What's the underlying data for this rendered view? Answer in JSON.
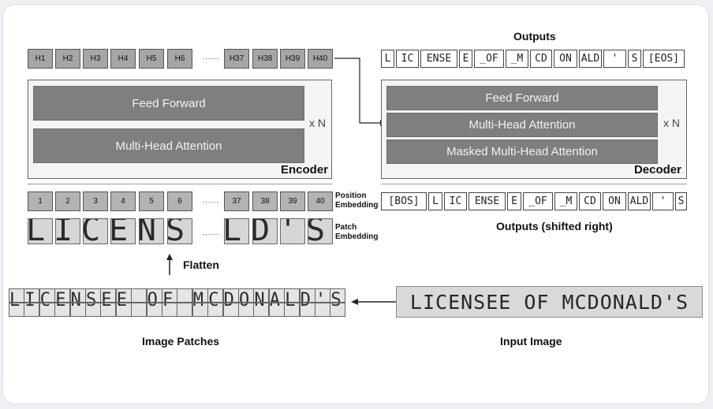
{
  "hidden_states": [
    "H1",
    "H2",
    "H3",
    "H4",
    "H5",
    "H6",
    "H37",
    "H38",
    "H39",
    "H40"
  ],
  "ellipsis": "......",
  "positions": [
    "1",
    "2",
    "3",
    "4",
    "5",
    "6",
    "37",
    "38",
    "39",
    "40"
  ],
  "patch_glyphs": [
    "L",
    "I",
    "C",
    "E",
    "N",
    "S",
    "L",
    "D",
    "'",
    "S"
  ],
  "encoder": {
    "feed_forward": "Feed Forward",
    "attention": "Multi-Head Attention",
    "repeat": "x N",
    "label": "Encoder"
  },
  "decoder": {
    "feed_forward": "Feed Forward",
    "attention": "Multi-Head Attention",
    "masked_attention": "Masked Multi-Head Attention",
    "repeat": "x N",
    "label": "Decoder"
  },
  "outputs_title": "Outputs",
  "output_tokens": [
    "L",
    "IC",
    "ENSE",
    "E",
    "_OF",
    "_M",
    "CD",
    "ON",
    "ALD",
    "'",
    "S",
    "[EOS]"
  ],
  "shifted_tokens": [
    "[BOS]",
    "L",
    "IC",
    "ENSE",
    "E",
    "_OF",
    "_M",
    "CD",
    "ON",
    "ALD",
    "'",
    "S"
  ],
  "shifted_caption": "Outputs (shifted right)",
  "position_embedding_label": [
    "Position",
    "Embedding"
  ],
  "patch_embedding_label": [
    "Patch",
    "Embedding"
  ],
  "flatten_label": "Flatten",
  "image_patches_caption": "Image Patches",
  "input_image_caption": "Input Image",
  "input_image_text": "LICENSEE OF MCDONALD'S",
  "image_patch_chars": [
    "L",
    "I",
    "C",
    "E",
    "N",
    "S",
    "E",
    "E",
    " ",
    "O",
    "F",
    " ",
    "M",
    "C",
    "D",
    "O",
    "N",
    "A",
    "L",
    "D",
    "'",
    "S"
  ],
  "colors": {
    "layer_fill": "#7f7f7f",
    "hidden_fill": "#a6a6a6",
    "stack_bg": "#f4f4f4"
  }
}
